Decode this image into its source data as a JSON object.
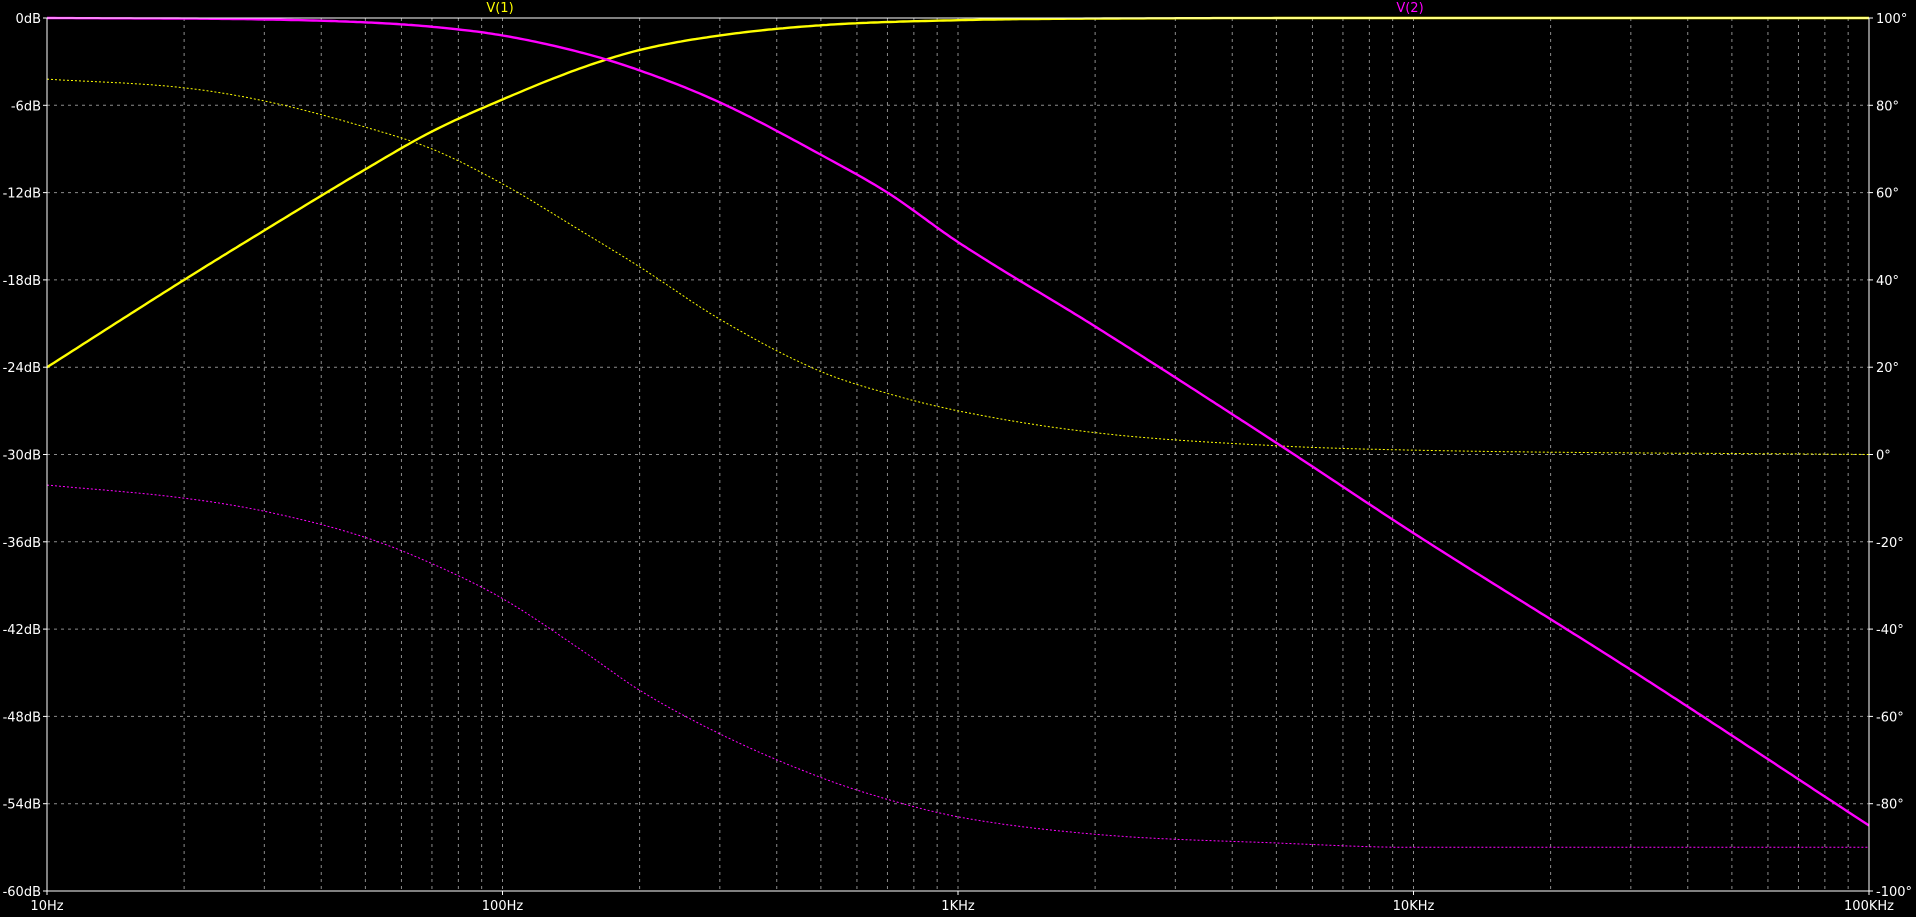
{
  "chart_data": {
    "type": "line",
    "x_scale": "log",
    "xlim": [
      10,
      100000
    ],
    "ylim_left": [
      -60,
      0
    ],
    "ylim_right": [
      -100,
      100
    ],
    "grid": true,
    "x_ticks": [
      "10Hz",
      "100Hz",
      "1KHz",
      "10KHz",
      "100KHz"
    ],
    "y_left_ticks": [
      "0dB",
      "-6dB",
      "-12dB",
      "-18dB",
      "-24dB",
      "-30dB",
      "-36dB",
      "-42dB",
      "-48dB",
      "-54dB",
      "-60dB"
    ],
    "y_right_ticks": [
      "100°",
      "80°",
      "60°",
      "40°",
      "20°",
      "0°",
      "-20°",
      "-40°",
      "-60°",
      "-80°",
      "-100°"
    ],
    "colors": {
      "background": "#000000",
      "grid": "#8c8c8c",
      "axis": "#ffffff",
      "v1": "#ffff00",
      "v2": "#ff00ff"
    },
    "series": [
      {
        "name": "V(1)",
        "color": "#ffff00",
        "magnitude_db": [
          {
            "x": 10,
            "y": -24.0
          },
          {
            "x": 20,
            "y": -18.0
          },
          {
            "x": 30,
            "y": -14.6
          },
          {
            "x": 50,
            "y": -10.4
          },
          {
            "x": 70,
            "y": -7.8
          },
          {
            "x": 100,
            "y": -5.6
          },
          {
            "x": 150,
            "y": -3.4
          },
          {
            "x": 200,
            "y": -2.2
          },
          {
            "x": 300,
            "y": -1.2
          },
          {
            "x": 500,
            "y": -0.5
          },
          {
            "x": 1000,
            "y": -0.15
          },
          {
            "x": 2000,
            "y": -0.04
          },
          {
            "x": 10000,
            "y": 0.0
          },
          {
            "x": 100000,
            "y": 0.0
          }
        ],
        "phase_deg": [
          {
            "x": 10,
            "y": 86
          },
          {
            "x": 20,
            "y": 84
          },
          {
            "x": 30,
            "y": 81
          },
          {
            "x": 50,
            "y": 75
          },
          {
            "x": 70,
            "y": 70
          },
          {
            "x": 100,
            "y": 62
          },
          {
            "x": 150,
            "y": 51
          },
          {
            "x": 200,
            "y": 43
          },
          {
            "x": 300,
            "y": 31
          },
          {
            "x": 500,
            "y": 19
          },
          {
            "x": 700,
            "y": 14
          },
          {
            "x": 1000,
            "y": 10
          },
          {
            "x": 2000,
            "y": 5
          },
          {
            "x": 5000,
            "y": 2
          },
          {
            "x": 10000,
            "y": 1
          },
          {
            "x": 100000,
            "y": 0
          }
        ]
      },
      {
        "name": "V(2)",
        "color": "#ff00ff",
        "magnitude_db": [
          {
            "x": 10,
            "y": 0.0
          },
          {
            "x": 30,
            "y": -0.1
          },
          {
            "x": 50,
            "y": -0.3
          },
          {
            "x": 70,
            "y": -0.6
          },
          {
            "x": 100,
            "y": -1.2
          },
          {
            "x": 150,
            "y": -2.4
          },
          {
            "x": 200,
            "y": -3.6
          },
          {
            "x": 300,
            "y": -5.8
          },
          {
            "x": 500,
            "y": -9.4
          },
          {
            "x": 700,
            "y": -12.0
          },
          {
            "x": 1000,
            "y": -15.4
          },
          {
            "x": 2000,
            "y": -21.2
          },
          {
            "x": 5000,
            "y": -29.2
          },
          {
            "x": 10000,
            "y": -35.4
          },
          {
            "x": 30000,
            "y": -44.8
          },
          {
            "x": 100000,
            "y": -55.5
          }
        ],
        "phase_deg": [
          {
            "x": 10,
            "y": -7
          },
          {
            "x": 20,
            "y": -10
          },
          {
            "x": 30,
            "y": -13
          },
          {
            "x": 50,
            "y": -19
          },
          {
            "x": 70,
            "y": -25
          },
          {
            "x": 100,
            "y": -33
          },
          {
            "x": 150,
            "y": -45
          },
          {
            "x": 200,
            "y": -54
          },
          {
            "x": 300,
            "y": -64
          },
          {
            "x": 500,
            "y": -74
          },
          {
            "x": 700,
            "y": -79
          },
          {
            "x": 1000,
            "y": -83
          },
          {
            "x": 2000,
            "y": -87
          },
          {
            "x": 5000,
            "y": -89
          },
          {
            "x": 10000,
            "y": -90
          },
          {
            "x": 100000,
            "y": -90
          }
        ]
      }
    ]
  }
}
